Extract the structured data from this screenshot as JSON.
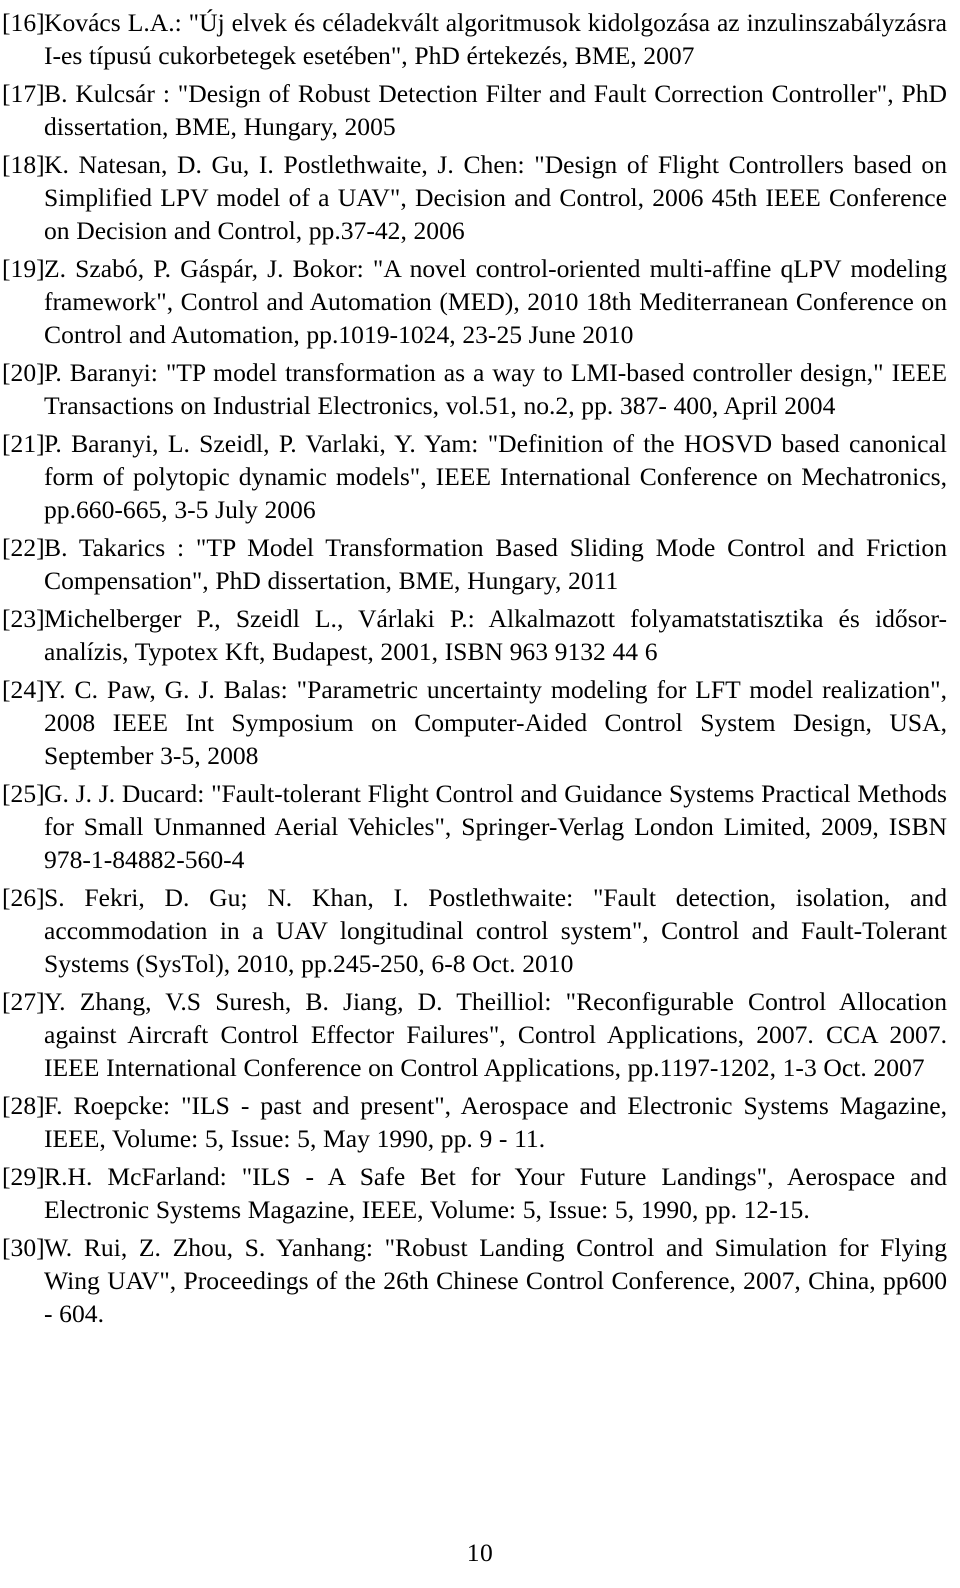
{
  "document": {
    "kind": "bibliography",
    "page_number": "10"
  },
  "references": [
    {
      "label": "[16]",
      "text": "Kovács L.A.: \"Új elvek és céladekvált algoritmusok kidolgozása az inzulinszabályzásra I-es típusú cukorbetegek esetében\", PhD értekezés, BME, 2007"
    },
    {
      "label": "[17]",
      "text": "B. Kulcsár : \"Design of Robust Detection Filter and Fault Correction Controller\", PhD dissertation, BME, Hungary, 2005"
    },
    {
      "label": "[18]",
      "text": "K. Natesan, D. Gu, I. Postlethwaite, J. Chen: \"Design of Flight Controllers based on Simplified LPV model of a UAV\", Decision and Control, 2006 45th IEEE Conference on Decision and Control, pp.37-42, 2006"
    },
    {
      "label": "[19]",
      "text": "Z. Szabó, P. Gáspár, J. Bokor: \"A novel control-oriented multi-affine qLPV modeling framework\", Control and Automation (MED), 2010 18th Mediterranean Conference on Control and Automation, pp.1019-1024, 23-25 June 2010"
    },
    {
      "label": "[20]",
      "text": "P. Baranyi: \"TP model transformation as a way to LMI-based controller design,\" IEEE Transactions on Industrial Electronics, vol.51, no.2, pp. 387- 400, April 2004"
    },
    {
      "label": "[21]",
      "text": "P. Baranyi, L. Szeidl, P. Varlaki, Y. Yam: \"Definition of the HOSVD based canonical form of polytopic dynamic models\", IEEE International Conference on Mechatronics, pp.660-665, 3-5 July 2006"
    },
    {
      "label": "[22]",
      "text": "B. Takarics : \"TP Model Transformation Based Sliding Mode Control and Friction Compensation\", PhD dissertation, BME, Hungary, 2011"
    },
    {
      "label": "[23]",
      "text": "Michelberger P., Szeidl L., Várlaki P.: Alkalmazott folyamatstatisztika és idősor-analízis, Typotex Kft, Budapest, 2001, ISBN 963 9132 44 6"
    },
    {
      "label": "[24]",
      "text": "Y. C. Paw, G. J. Balas: \"Parametric uncertainty modeling for LFT model realization\", 2008 IEEE Int Symposium on Computer-Aided Control System Design, USA, September 3-5, 2008"
    },
    {
      "label": "[25]",
      "text": "G. J. J. Ducard: \"Fault-tolerant Flight Control and Guidance Systems Practical Methods for Small Unmanned Aerial Vehicles\", Springer-Verlag London Limited, 2009, ISBN 978-1-84882-560-4"
    },
    {
      "label": "[26]",
      "text": "S. Fekri, D. Gu; N. Khan, I. Postlethwaite: \"Fault detection, isolation, and accommodation in a UAV longitudinal control system\", Control and Fault-Tolerant Systems (SysTol), 2010, pp.245-250, 6-8 Oct. 2010"
    },
    {
      "label": "[27]",
      "text": "Y. Zhang, V.S Suresh, B. Jiang, D. Theilliol: \"Reconfigurable Control Allocation against Aircraft Control Effector Failures\", Control Applications, 2007. CCA 2007. IEEE International Conference on Control Applications, pp.1197-1202, 1-3 Oct. 2007"
    },
    {
      "label": "[28]",
      "text": "F. Roepcke: \"ILS - past and present\", Aerospace and Electronic Systems Magazine, IEEE, Volume: 5, Issue: 5, May 1990, pp. 9 - 11."
    },
    {
      "label": "[29]",
      "text": "R.H. McFarland: \"ILS - A Safe Bet for Your Future Landings\", Aerospace and Electronic Systems Magazine, IEEE, Volume: 5, Issue: 5, 1990, pp. 12-15."
    },
    {
      "label": "[30]",
      "text": "W. Rui, Z. Zhou, S. Yanhang: \"Robust Landing Control and Simulation for Flying Wing UAV\", Proceedings of the 26th Chinese Control Conference, 2007, China, pp600 - 604."
    }
  ]
}
